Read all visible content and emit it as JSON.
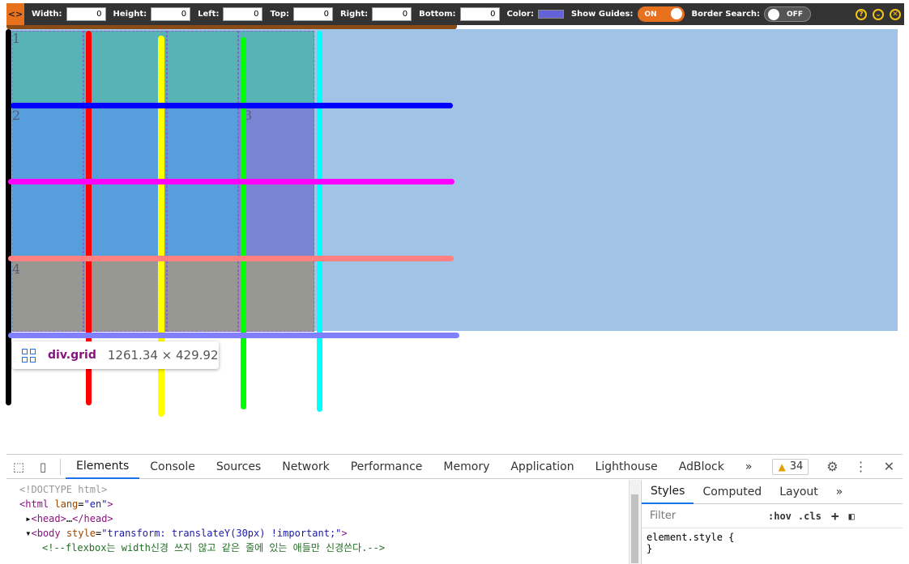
{
  "toolbar": {
    "fields": [
      {
        "label": "Width:",
        "value": "0"
      },
      {
        "label": "Height:",
        "value": "0"
      },
      {
        "label": "Left:",
        "value": "0"
      },
      {
        "label": "Top:",
        "value": "0"
      },
      {
        "label": "Right:",
        "value": "0"
      },
      {
        "label": "Bottom:",
        "value": "0"
      }
    ],
    "color_label": "Color:",
    "color_value": "#6562d9",
    "show_guides_label": "Show Guides:",
    "show_guides_state": "ON",
    "border_search_label": "Border Search:",
    "border_search_state": "OFF",
    "logo_glyph": "<>",
    "icons": [
      "help-icon",
      "collapse-icon",
      "close-icon"
    ]
  },
  "grid": {
    "cell_labels": [
      "1",
      "2",
      "3",
      "4"
    ],
    "colors": {
      "teal": "#58b3b6",
      "blue": "#579fdc",
      "purple": "#7985d0",
      "gray": "#989893",
      "background": "#a1c3e6"
    }
  },
  "guides": {
    "colors": [
      "#000000",
      "#ff0000",
      "#ffff00",
      "#00ff00",
      "#00ffff",
      "#0000ff",
      "#ff00ff",
      "#ff8080",
      "#8080ff"
    ]
  },
  "tooltip": {
    "element": "div.grid",
    "size": "1261.34 × 429.92"
  },
  "devtools": {
    "tabs": [
      "Elements",
      "Console",
      "Sources",
      "Network",
      "Performance",
      "Memory",
      "Application",
      "Lighthouse",
      "AdBlock"
    ],
    "active_tab": "Elements",
    "more_tabs": "»",
    "warning_count": "34",
    "code_lines": {
      "doctype": "<!DOCTYPE html>",
      "html_tag": "html",
      "html_attr": "lang",
      "html_val": "\"en\"",
      "head": "head",
      "head_ellipsis": "…",
      "body_tag": "body",
      "body_attr": "style",
      "body_val": "\"transform: translateY(30px) !important;\"",
      "comment": "<!--flexbox는 width신경 쓰지 않고 같은 줄에 있는 애들만 신경쓴다.-->"
    },
    "styles_tabs": [
      "Styles",
      "Computed",
      "Layout"
    ],
    "styles_more": "»",
    "filter_placeholder": "Filter",
    "hov": ":hov",
    "cls": ".cls",
    "element_style": "element.style {",
    "close_brace": "}"
  }
}
